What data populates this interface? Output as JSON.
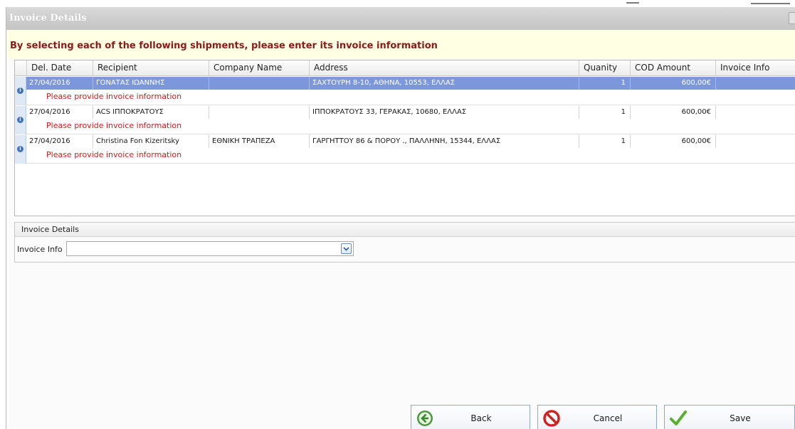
{
  "window": {
    "title": "Invoice Details"
  },
  "instruction": "By selecting each of the following shipments, please enter its invoice information",
  "grid": {
    "columns": [
      "Del. Date",
      "Recipient",
      "Company Name",
      "Address",
      "Quanity",
      "COD Amount",
      "Invoice Info"
    ],
    "rows": [
      {
        "del_date": "27/04/2016",
        "recipient": "ΓΟΝΑΤΑΣ ΙΩΑΝΝΗΣ",
        "company": "",
        "address": "ΣΑΧΤΟΥΡΗ 8-10, ΑΘΗΝΑ, 10553, ΕΛΛΑΣ",
        "quantity": "1",
        "cod_amount": "600,00€",
        "invoice_info": "",
        "warning": "Please provide invoice information",
        "selected": true
      },
      {
        "del_date": "27/04/2016",
        "recipient": "ACS ΙΠΠΟΚΡΑΤΟΥΣ",
        "company": "",
        "address": "ΙΠΠΟΚΡΑΤΟΥΣ 33, ΓΕΡΑΚΑΣ, 10680, ΕΛΛΑΣ",
        "quantity": "1",
        "cod_amount": "600,00€",
        "invoice_info": "",
        "warning": "Please provide invoice information",
        "selected": false
      },
      {
        "del_date": "27/04/2016",
        "recipient": "Christina Fon Kizeritsky",
        "company": "ΕΘΝΙΚΗ ΤΡΑΠΕΖΑ",
        "address": "ΓΑΡΓΗΤΤΟΥ 86 & ΠΟΡΟΥ ., ΠΑΛΛΗΝΗ, 15344, ΕΛΛΑΣ",
        "quantity": "1",
        "cod_amount": "600,00€",
        "invoice_info": "",
        "warning": "Please provide invoice information",
        "selected": false
      }
    ]
  },
  "details_panel": {
    "title": "Invoice Details",
    "field_label": "Invoice Info",
    "field_value": ""
  },
  "buttons": {
    "back": "Back",
    "cancel": "Cancel",
    "save": "Save"
  },
  "colors": {
    "selected_row": "#7d97dc",
    "instruction_text": "#8b1a1a",
    "warning_text": "#cc1f1f",
    "instruction_bg": "#ffffe3"
  },
  "icons": {
    "row_indicator": "info-icon",
    "back": "back-arrow-icon",
    "cancel": "cancel-icon",
    "save": "checkmark-icon",
    "combo": "chevron-down-icon"
  }
}
